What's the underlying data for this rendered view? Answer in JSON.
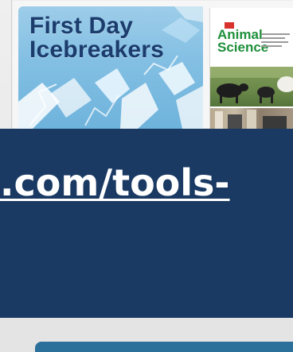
{
  "card": {
    "icebreakers_title_line1": "First Day",
    "icebreakers_title_line2": "Icebreakers",
    "book_title_line1": "Animal",
    "book_title_line2": "Science"
  },
  "banner": {
    "link_text": ".com/tools-"
  },
  "colors": {
    "banner_bg": "#1a3a63",
    "ice_blue": "#83bfe3",
    "title_navy": "#1b3c6c",
    "book_green": "#1e8f3a",
    "button_blue": "#2b6f9b"
  }
}
